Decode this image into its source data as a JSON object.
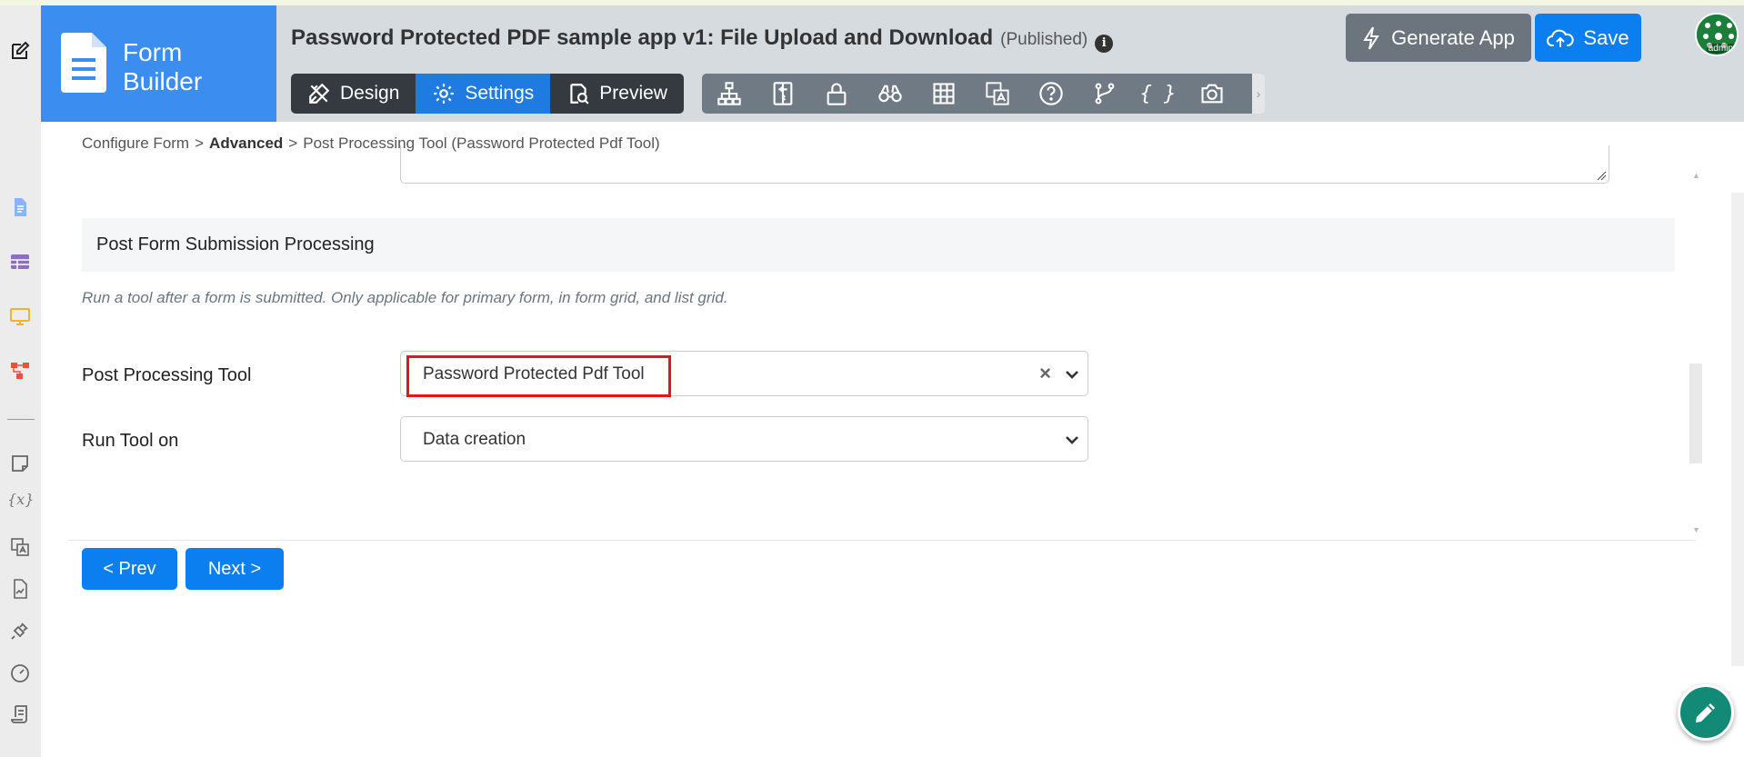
{
  "brand": {
    "line1": "Form",
    "line2": "Builder"
  },
  "header": {
    "app_title": "Password Protected PDF sample app v1: File Upload and Download",
    "status": "(Published)",
    "info_glyph": "i",
    "generate_label": "Generate App",
    "save_label": "Save",
    "avatar_label": "admin"
  },
  "mode_tabs": [
    {
      "label": "Design",
      "icon": "design-tools-icon"
    },
    {
      "label": "Settings",
      "icon": "gear-icon",
      "active": true
    },
    {
      "label": "Preview",
      "icon": "preview-search-icon"
    }
  ],
  "toolbar_icons": [
    "hierarchy-icon",
    "column-layout-icon",
    "lock-icon",
    "binoculars-icon",
    "grid-icon",
    "translate-icon",
    "help-circle-icon",
    "branch-icon",
    "braces-icon",
    "camera-icon"
  ],
  "toolbar_braces": "{ }",
  "toolbar_more": "›",
  "rail": {
    "variable_glyph": "{x}"
  },
  "breadcrumb": {
    "item1": "Configure Form",
    "item2": "Advanced",
    "item3": "Post Processing Tool (Password Protected Pdf Tool)",
    "separator": ">"
  },
  "section": {
    "title": "Post Form Submission Processing",
    "description": "Run a tool after a form is submitted. Only applicable for primary form, in form grid, and list grid."
  },
  "fields": {
    "tool_label": "Post Processing Tool",
    "tool_value": "Password Protected Pdf Tool",
    "tool_clear": "×",
    "run_label": "Run Tool on",
    "run_value": "Data creation"
  },
  "nav": {
    "prev_label": "< Prev",
    "next_label": "Next >"
  },
  "colors": {
    "brand_blue": "#3b8df0",
    "primary": "#0b7fef",
    "dark": "#343a40",
    "highlight": "#e8141c",
    "fab": "#138a75"
  }
}
